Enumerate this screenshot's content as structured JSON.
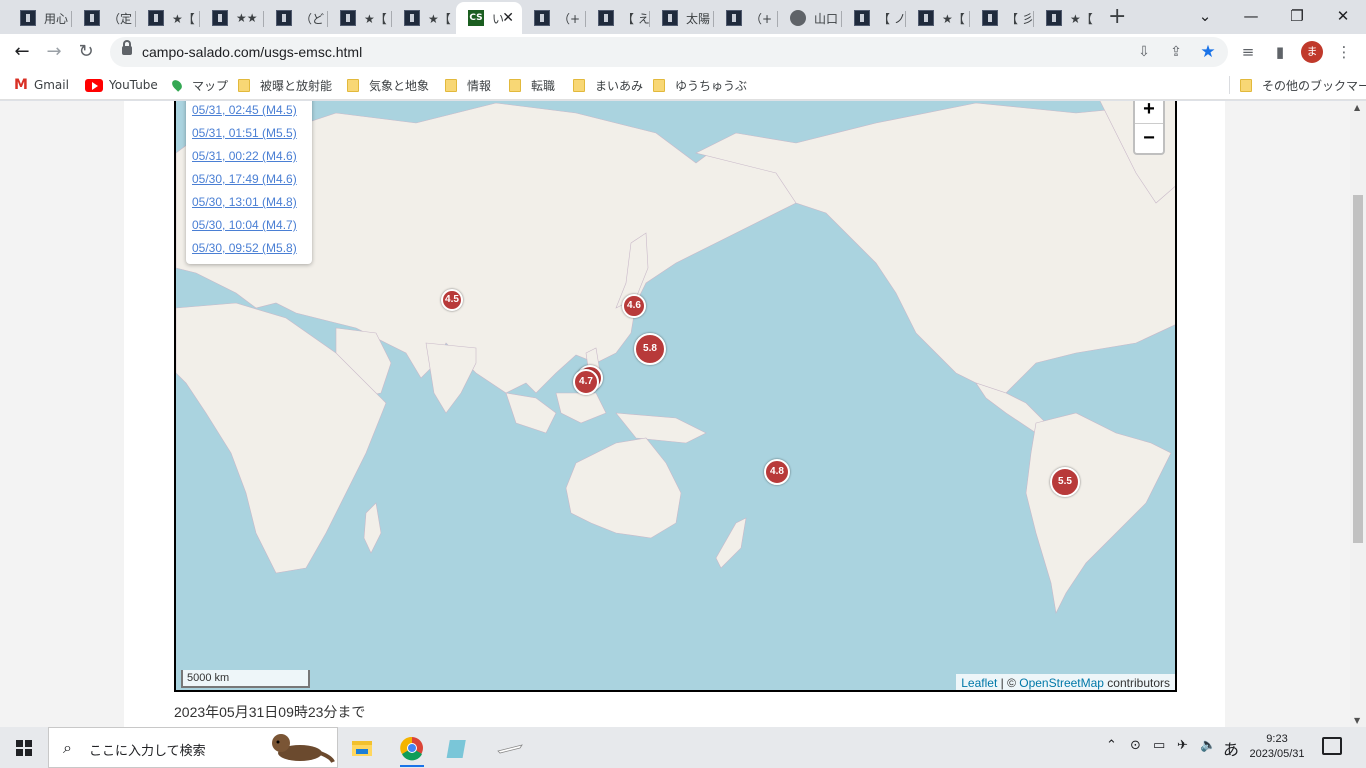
{
  "tabs": [
    {
      "label": "用心",
      "icon": "site-icon"
    },
    {
      "label": "（定",
      "icon": "site-icon"
    },
    {
      "label": "★【",
      "icon": "site-icon"
    },
    {
      "label": "★★",
      "icon": "site-icon"
    },
    {
      "label": "（ど",
      "icon": "site-icon"
    },
    {
      "label": "★【",
      "icon": "site-icon"
    },
    {
      "label": "★【",
      "icon": "site-icon"
    },
    {
      "label": "い",
      "icon": "cs-icon",
      "active": true
    },
    {
      "label": "（+",
      "icon": "site-icon"
    },
    {
      "label": "【 え",
      "icon": "site-icon"
    },
    {
      "label": "太陽",
      "icon": "site-icon"
    },
    {
      "label": "（+",
      "icon": "site-icon"
    },
    {
      "label": "山口",
      "icon": "globe-icon"
    },
    {
      "label": "【 ノ",
      "icon": "site-icon"
    },
    {
      "label": "★【",
      "icon": "site-icon"
    },
    {
      "label": "【 彡",
      "icon": "site-icon"
    },
    {
      "label": "★【",
      "icon": "site-icon"
    }
  ],
  "active_tab_favicon_text": "CS",
  "omnibox": {
    "url": "campo-salado.com/usgs-emsc.html"
  },
  "profile_initial": "ま",
  "bookmarks": [
    {
      "label": "Gmail",
      "icon": "gmail-icon"
    },
    {
      "label": "YouTube",
      "icon": "youtube-icon"
    },
    {
      "label": "マップ",
      "icon": "maps-icon"
    },
    {
      "label": "被曝と放射能",
      "icon": "folder-icon"
    },
    {
      "label": "気象と地象",
      "icon": "folder-icon"
    },
    {
      "label": "情報",
      "icon": "folder-icon"
    },
    {
      "label": "転職",
      "icon": "folder-icon"
    },
    {
      "label": "まいあみ",
      "icon": "folder-icon"
    },
    {
      "label": "ゆうちゅうぶ",
      "icon": "folder-icon"
    }
  ],
  "other_bookmarks": "その他のブックマーク",
  "earthquake_list": [
    "05/31, 02:45 (M4.5)",
    "05/31, 01:51 (M5.5)",
    "05/31, 00:22 (M4.6)",
    "05/30, 17:49 (M4.6)",
    "05/30, 13:01 (M4.8)",
    "05/30, 10:04 (M4.7)",
    "05/30, 09:52 (M5.8)"
  ],
  "markers": [
    "4.5",
    "4.6",
    "5.8",
    "4.6",
    "4.7",
    "4.8",
    "5.5"
  ],
  "zoom": {
    "in": "+",
    "out": "−"
  },
  "scale_label": "5000 km",
  "attribution": {
    "leaflet": "Leaflet",
    "sep": " | © ",
    "osm": "OpenStreetMap",
    "rest": " contributors"
  },
  "updated_text": "2023年05月31日09時23分まで",
  "taskbar": {
    "search_placeholder": "ここに入力して検索",
    "ime": "あ",
    "time": "9:23",
    "date": "2023/05/31"
  },
  "colors": {
    "marker": "#b83a3a",
    "sea": "#aad3df",
    "land": "#f2efe9",
    "link": "#4a7fd4"
  }
}
